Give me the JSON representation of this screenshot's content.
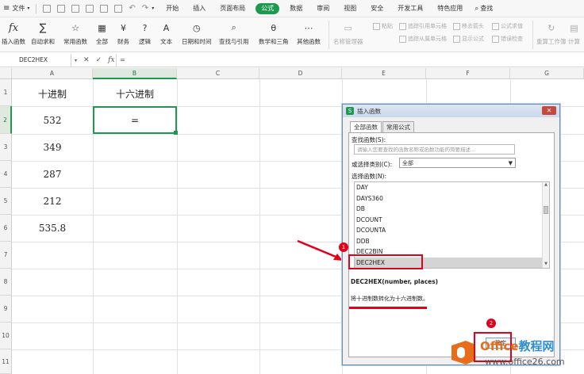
{
  "menubar": {
    "file": "文件",
    "tabs": [
      "开始",
      "插入",
      "页面布局",
      "公式",
      "数据",
      "审阅",
      "视图",
      "安全",
      "开发工具",
      "特色应用"
    ],
    "active_tab": "公式",
    "search": "查找"
  },
  "ribbon": {
    "insert_function": "插入函数",
    "autosum": "自动求和",
    "common_functions": "常用函数",
    "all": "全部",
    "finance": "财务",
    "logic": "逻辑",
    "text": "文本",
    "datetime": "日期和时间",
    "lookup": "查找与引用",
    "math": "数学和三角",
    "other": "其他函数",
    "name_manager": "名称管理器",
    "paste": "粘贴",
    "trace_precedents": "追踪引用单元格",
    "trace_dependents": "追踪从属单元格",
    "remove_arrows": "移去箭头",
    "show_formulas": "显示公式",
    "formula_eval": "公式求值",
    "error_check": "错误检查",
    "recalc": "重算工作簿",
    "calc": "计算"
  },
  "formulabar": {
    "cell_ref": "DEC2HEX",
    "fx": "fx",
    "content": "="
  },
  "grid": {
    "columns": [
      "A",
      "B",
      "C",
      "D",
      "E",
      "F",
      "G"
    ],
    "rows": [
      "1",
      "2",
      "3",
      "4",
      "5",
      "6",
      "7",
      "8",
      "9",
      "10",
      "11"
    ],
    "header_a": "十进制",
    "header_b": "十六进制",
    "values": [
      "532",
      "349",
      "287",
      "212",
      "535.8"
    ],
    "b2": "="
  },
  "dialog": {
    "title": "插入函数",
    "tab_all": "全部函数",
    "tab_common": "常用公式",
    "search_label": "查找函数(S):",
    "search_placeholder": "请输入您要查找的函数名称或函数功能的简要描述...",
    "category_label": "或选择类别(C):",
    "category_value": "全部",
    "select_label": "选择函数(N):",
    "functions": [
      "DAY",
      "DAYS360",
      "DB",
      "DCOUNT",
      "DCOUNTA",
      "DDB",
      "DEC2BIN",
      "DEC2HEX"
    ],
    "selected_function": "DEC2HEX",
    "signature": "DEC2HEX(number, places)",
    "description": "将十进制数转化为十六进制数。",
    "ok": "确定"
  },
  "annotations": {
    "badge1": "1",
    "badge2": "2"
  },
  "watermark": {
    "brand_a": "Office",
    "brand_b": "教程网",
    "url": "www.office26.com"
  }
}
